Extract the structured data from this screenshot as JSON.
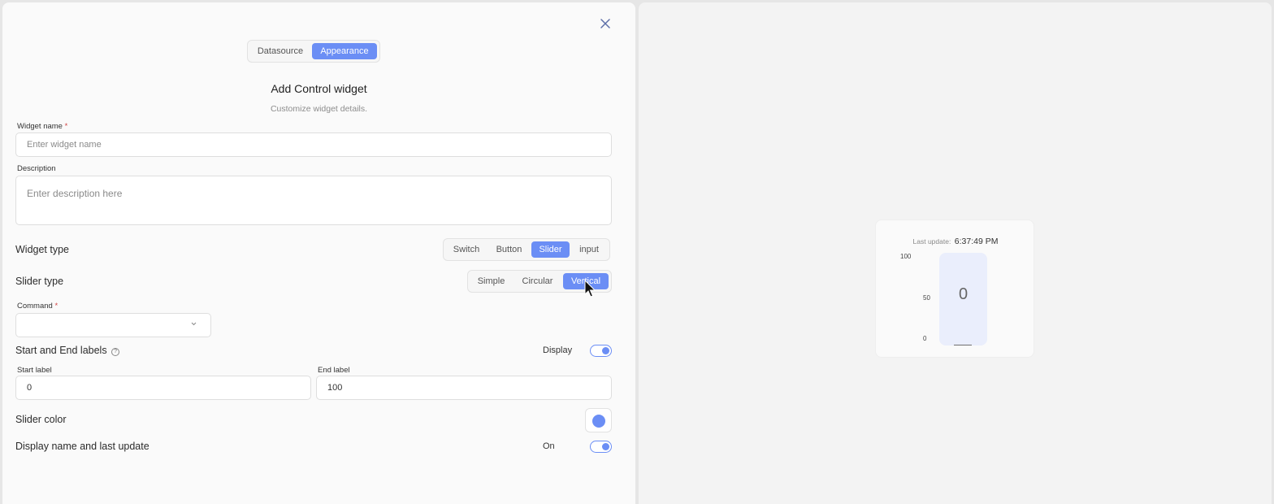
{
  "editor": {
    "tabs": [
      {
        "label": "Datasource",
        "active": false
      },
      {
        "label": "Appearance",
        "active": true
      }
    ],
    "title": "Add Control widget",
    "subtitle": "Customize widget details.",
    "widget_name": {
      "label": "Widget name",
      "required_mark": "*",
      "placeholder": "Enter widget name",
      "value": ""
    },
    "description": {
      "label": "Description",
      "placeholder": "Enter description here",
      "value": ""
    },
    "widget_type": {
      "label": "Widget type",
      "options": [
        "Switch",
        "Button",
        "Slider",
        "input"
      ],
      "selected": "Slider"
    },
    "slider_type": {
      "label": "Slider type",
      "options": [
        "Simple",
        "Circular",
        "Vertical"
      ],
      "selected": "Vertical"
    },
    "command": {
      "label": "Command",
      "required_mark": "*",
      "value": ""
    },
    "start_end_labels": {
      "label": "Start and End labels",
      "help_icon": "question-mark",
      "toggle_label": "Display",
      "toggle_on": true,
      "start_label": {
        "label": "Start label",
        "value": "0"
      },
      "end_label": {
        "label": "End label",
        "value": "100"
      }
    },
    "slider_color": {
      "label": "Slider color",
      "value": "#6b8ef5"
    },
    "display_name_last_update": {
      "label": "Display name and last update",
      "toggle_label": "On",
      "toggle_on": true
    }
  },
  "preview": {
    "last_update_label": "Last update:",
    "last_update_time": "6:37:49 PM",
    "ticks": [
      "100",
      "50",
      "0"
    ],
    "value": "0",
    "fill_fraction": 0,
    "colors": {
      "accent": "#6b8ef5",
      "track": "#eaeefc"
    }
  }
}
